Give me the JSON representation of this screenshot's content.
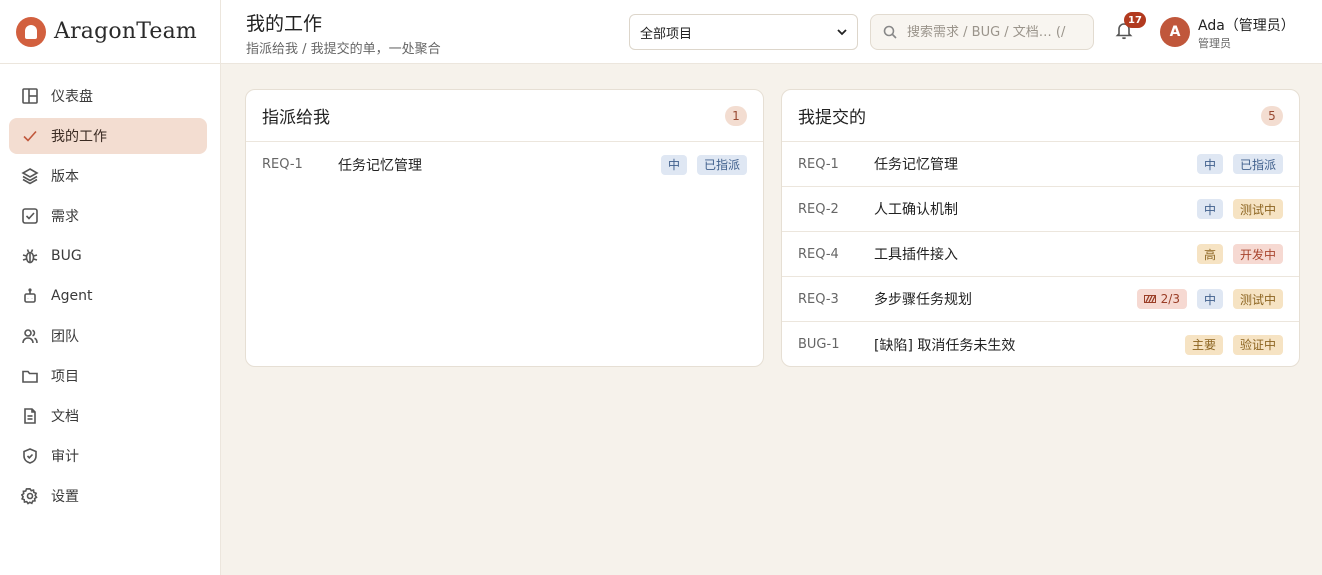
{
  "brand": {
    "name": "AragonTeam"
  },
  "sidebar": {
    "items": [
      {
        "label": "仪表盘",
        "icon": "dashboard-icon",
        "active": false
      },
      {
        "label": "我的工作",
        "icon": "check-icon",
        "active": true
      },
      {
        "label": "版本",
        "icon": "layers-icon",
        "active": false
      },
      {
        "label": "需求",
        "icon": "checkbox-icon",
        "active": false
      },
      {
        "label": "BUG",
        "icon": "bug-icon",
        "active": false
      },
      {
        "label": "Agent",
        "icon": "robot-icon",
        "active": false
      },
      {
        "label": "团队",
        "icon": "users-icon",
        "active": false
      },
      {
        "label": "项目",
        "icon": "folder-icon",
        "active": false
      },
      {
        "label": "文档",
        "icon": "document-icon",
        "active": false
      },
      {
        "label": "审计",
        "icon": "shield-icon",
        "active": false
      },
      {
        "label": "设置",
        "icon": "gear-icon",
        "active": false
      }
    ]
  },
  "header": {
    "title": "我的工作",
    "subtitle": "指派给我 / 我提交的单，一处聚合",
    "project_select": "全部项目",
    "search_placeholder": "搜索需求 / BUG / 文档… (/",
    "notification_count": "17",
    "user": {
      "initial": "A",
      "name": "Ada（管理员）",
      "role": "管理员"
    }
  },
  "panels": {
    "assigned": {
      "title": "指派给我",
      "count": "1",
      "rows": [
        {
          "id": "REQ-1",
          "title": "任务记忆管理",
          "tags": [
            {
              "text": "中",
              "kind": "blue"
            },
            {
              "text": "已指派",
              "kind": "blue"
            }
          ]
        }
      ]
    },
    "submitted": {
      "title": "我提交的",
      "count": "5",
      "rows": [
        {
          "id": "REQ-1",
          "title": "任务记忆管理",
          "tags": [
            {
              "text": "中",
              "kind": "blue"
            },
            {
              "text": "已指派",
              "kind": "blue"
            }
          ]
        },
        {
          "id": "REQ-2",
          "title": "人工确认机制",
          "tags": [
            {
              "text": "中",
              "kind": "blue"
            },
            {
              "text": "测试中",
              "kind": "amber"
            }
          ]
        },
        {
          "id": "REQ-4",
          "title": "工具插件接入",
          "tags": [
            {
              "text": "高",
              "kind": "amber"
            },
            {
              "text": "开发中",
              "kind": "red"
            }
          ]
        },
        {
          "id": "REQ-3",
          "title": "多步骤任务规划",
          "progress": "2/3",
          "tags": [
            {
              "text": "中",
              "kind": "blue"
            },
            {
              "text": "测试中",
              "kind": "amber"
            }
          ]
        },
        {
          "id": "BUG-1",
          "title": "[缺陷] 取消任务未生效",
          "tags": [
            {
              "text": "主要",
              "kind": "amber"
            },
            {
              "text": "验证中",
              "kind": "amber"
            }
          ]
        }
      ]
    }
  }
}
